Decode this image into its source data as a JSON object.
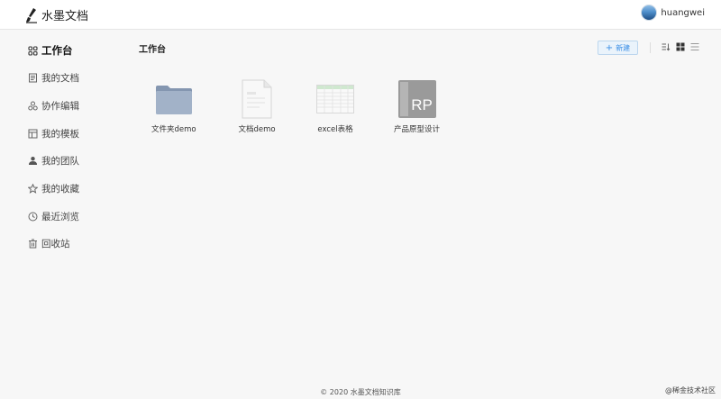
{
  "header": {
    "app_name": "水墨文档",
    "username": "huangwei"
  },
  "sidebar": {
    "items": [
      {
        "label": "工作台",
        "icon": "grid-icon",
        "active": true
      },
      {
        "label": "我的文档",
        "icon": "document-icon",
        "active": false
      },
      {
        "label": "协作编辑",
        "icon": "collaborate-icon",
        "active": false
      },
      {
        "label": "我的模板",
        "icon": "template-icon",
        "active": false
      },
      {
        "label": "我的团队",
        "icon": "team-icon",
        "active": false
      },
      {
        "label": "我的收藏",
        "icon": "star-icon",
        "active": false
      },
      {
        "label": "最近浏览",
        "icon": "clock-icon",
        "active": false
      },
      {
        "label": "回收站",
        "icon": "trash-icon",
        "active": false
      }
    ]
  },
  "main": {
    "title": "工作台",
    "new_button": "新建",
    "files": [
      {
        "name": "文件夹demo",
        "icon": "folder-icon"
      },
      {
        "name": "文档demo",
        "icon": "doc-file-icon"
      },
      {
        "name": "excel表格",
        "icon": "sheet-file-icon"
      },
      {
        "name": "产品原型设计",
        "icon": "rp-file-icon"
      }
    ]
  },
  "footer": {
    "copyright": "© 2020 水墨文档知识库",
    "watermark": "@稀金技术社区"
  },
  "colors": {
    "accent": "#3a8ee6",
    "background": "#f7f7f7"
  }
}
